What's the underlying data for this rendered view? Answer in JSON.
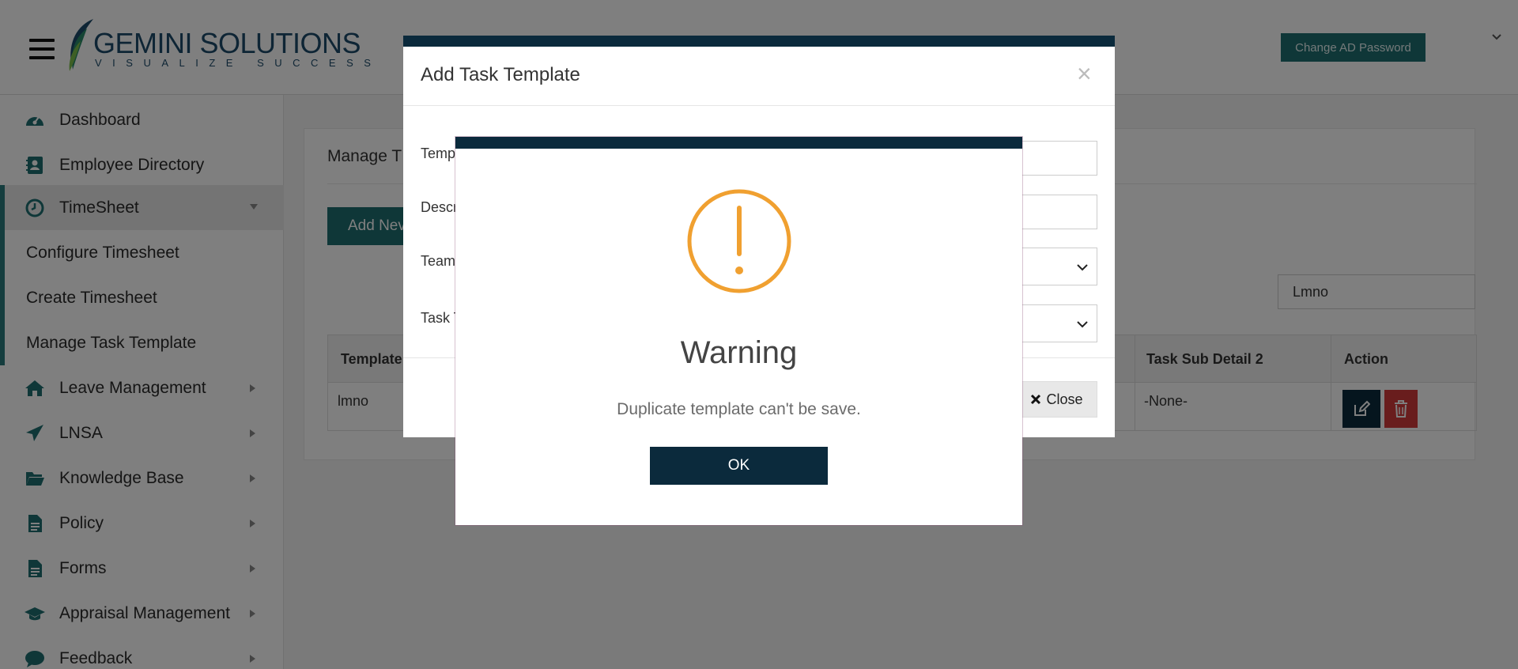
{
  "header": {
    "logo_name_bold": "GEMINI",
    "logo_name_rest": " SOLUTIONS",
    "logo_tagline": "VISUALIZE SUCCESS",
    "change_password_label": "Change AD Password"
  },
  "sidebar": {
    "items": [
      {
        "label": "Dashboard",
        "icon": "dashboard-icon"
      },
      {
        "label": "Employee Directory",
        "icon": "contact-card-icon"
      },
      {
        "label": "TimeSheet",
        "icon": "clock-icon"
      },
      {
        "label": "Configure Timesheet"
      },
      {
        "label": "Create Timesheet"
      },
      {
        "label": "Manage Task Template"
      },
      {
        "label": "Leave Management",
        "icon": "home-icon"
      },
      {
        "label": "LNSA",
        "icon": "paper-plane-icon"
      },
      {
        "label": "Knowledge Base",
        "icon": "folder-open-icon"
      },
      {
        "label": "Policy",
        "icon": "document-icon"
      },
      {
        "label": "Forms",
        "icon": "document-icon"
      },
      {
        "label": "Appraisal Management",
        "icon": "graduation-cap-icon"
      },
      {
        "label": "Feedback",
        "icon": "chat-icon"
      }
    ]
  },
  "main": {
    "title": "Manage T",
    "add_button_label": "Add Nev",
    "search_value": "Lmno",
    "table": {
      "headers": [
        "Template",
        "Task Sub Detail 2",
        "Action"
      ],
      "row": {
        "template": "lmno",
        "task_sub_detail_2": "-None-"
      }
    }
  },
  "add_modal": {
    "title": "Add Task Template",
    "close_x": "×",
    "labels": [
      "Temp",
      "Descr",
      "Team",
      "Task T"
    ],
    "close_button_label": "Close"
  },
  "warning_modal": {
    "title": "Warning",
    "message": "Duplicate template can't be save.",
    "ok_label": "OK",
    "icon_color": "#f0a030"
  },
  "colors": {
    "teal": "#1e6e70",
    "navy": "#0b2a3c",
    "danger": "#d23a3a"
  }
}
